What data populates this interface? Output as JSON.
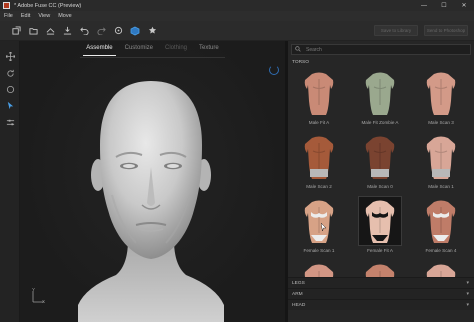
{
  "window": {
    "title": "* Adobe Fuse CC (Preview)",
    "controls": [
      "—",
      "☐",
      "✕"
    ]
  },
  "menu": [
    "File",
    "Edit",
    "View",
    "Move"
  ],
  "toolbar": {
    "icons": [
      "new-icon",
      "open-icon",
      "save-icon",
      "export-icon",
      "undo-icon",
      "redo-icon",
      "settings-icon",
      "model-icon",
      "star-icon"
    ],
    "right_buttons": [
      "Save to Library",
      "Send to Photoshop"
    ]
  },
  "leftbar": {
    "icons": [
      "move-icon",
      "rotate-icon",
      "scale-icon",
      "select-icon",
      "adjust-icon"
    ]
  },
  "viewport": {
    "tabs": [
      {
        "label": "Assemble",
        "state": "active"
      },
      {
        "label": "Customize",
        "state": "normal"
      },
      {
        "label": "Clothing",
        "state": "disabled"
      },
      {
        "label": "Texture",
        "state": "normal"
      }
    ],
    "axis": {
      "y": "Y",
      "x": "X"
    }
  },
  "library": {
    "search_placeholder": "Search",
    "section": "TORSO",
    "items": [
      {
        "label": "Male Fit A",
        "skin": "#c98a76",
        "cloth": "none"
      },
      {
        "label": "Male Fit Zombie A",
        "skin": "#9aa88e",
        "cloth": "none"
      },
      {
        "label": "Male Scan 3",
        "skin": "#d39a88",
        "cloth": "none"
      },
      {
        "label": "Male Scan 2",
        "skin": "#a55a3a",
        "cloth": "shorts"
      },
      {
        "label": "Male Scan 0",
        "skin": "#7a4330",
        "cloth": "shorts"
      },
      {
        "label": "Male Scan 1",
        "skin": "#d8a697",
        "cloth": "shorts"
      },
      {
        "label": "Female Scan 1",
        "skin": "#d7a286",
        "cloth": "bikini"
      },
      {
        "label": "Female Fit A",
        "skin": "#e6bfae",
        "cloth": "bikini",
        "selected": true
      },
      {
        "label": "Female Scan 4",
        "skin": "#bf7c68",
        "cloth": "bikini"
      },
      {
        "label": "",
        "skin": "#d29684",
        "cloth": "none"
      },
      {
        "label": "",
        "skin": "#c4826c",
        "cloth": "none"
      },
      {
        "label": "",
        "skin": "#d8a697",
        "cloth": "none"
      }
    ],
    "collapsed_sections": [
      "LEGS",
      "ARM",
      "HEAD"
    ]
  },
  "colors": {
    "accent": "#4aa0e8",
    "background": "#1b1b1b",
    "panel": "#262626"
  }
}
